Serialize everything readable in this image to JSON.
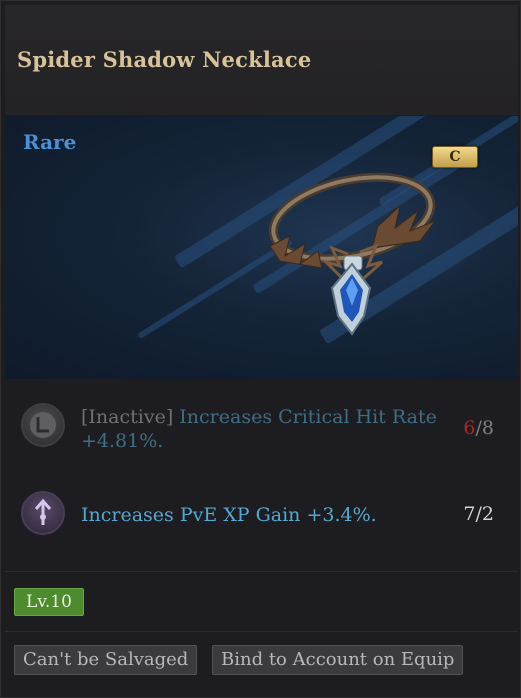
{
  "item": {
    "name": "Spider Shadow Necklace",
    "rarity": "Rare",
    "grade": "C",
    "level": "Lv.10"
  },
  "stats": [
    {
      "icon": "inactive-skill-icon",
      "prefix": "[Inactive]",
      "description": "Increases Critical Hit Rate +4.81%.",
      "count_current": "6",
      "count_separator": "/",
      "count_total": "8",
      "active": false
    },
    {
      "icon": "xp-gain-icon",
      "description": "Increases PvE XP Gain +3.4%.",
      "count": "7/2",
      "active": true
    }
  ],
  "tags": [
    "Can't be Salvaged",
    "Bind to Account on Equip"
  ],
  "colors": {
    "title": "#d8c29a",
    "rarity": "#4d8fd6",
    "active_stat": "#55a8cf",
    "inactive_stat": "#3f6d83",
    "count_deficit": "#a42b26",
    "level_badge": "#4e8a2e"
  }
}
